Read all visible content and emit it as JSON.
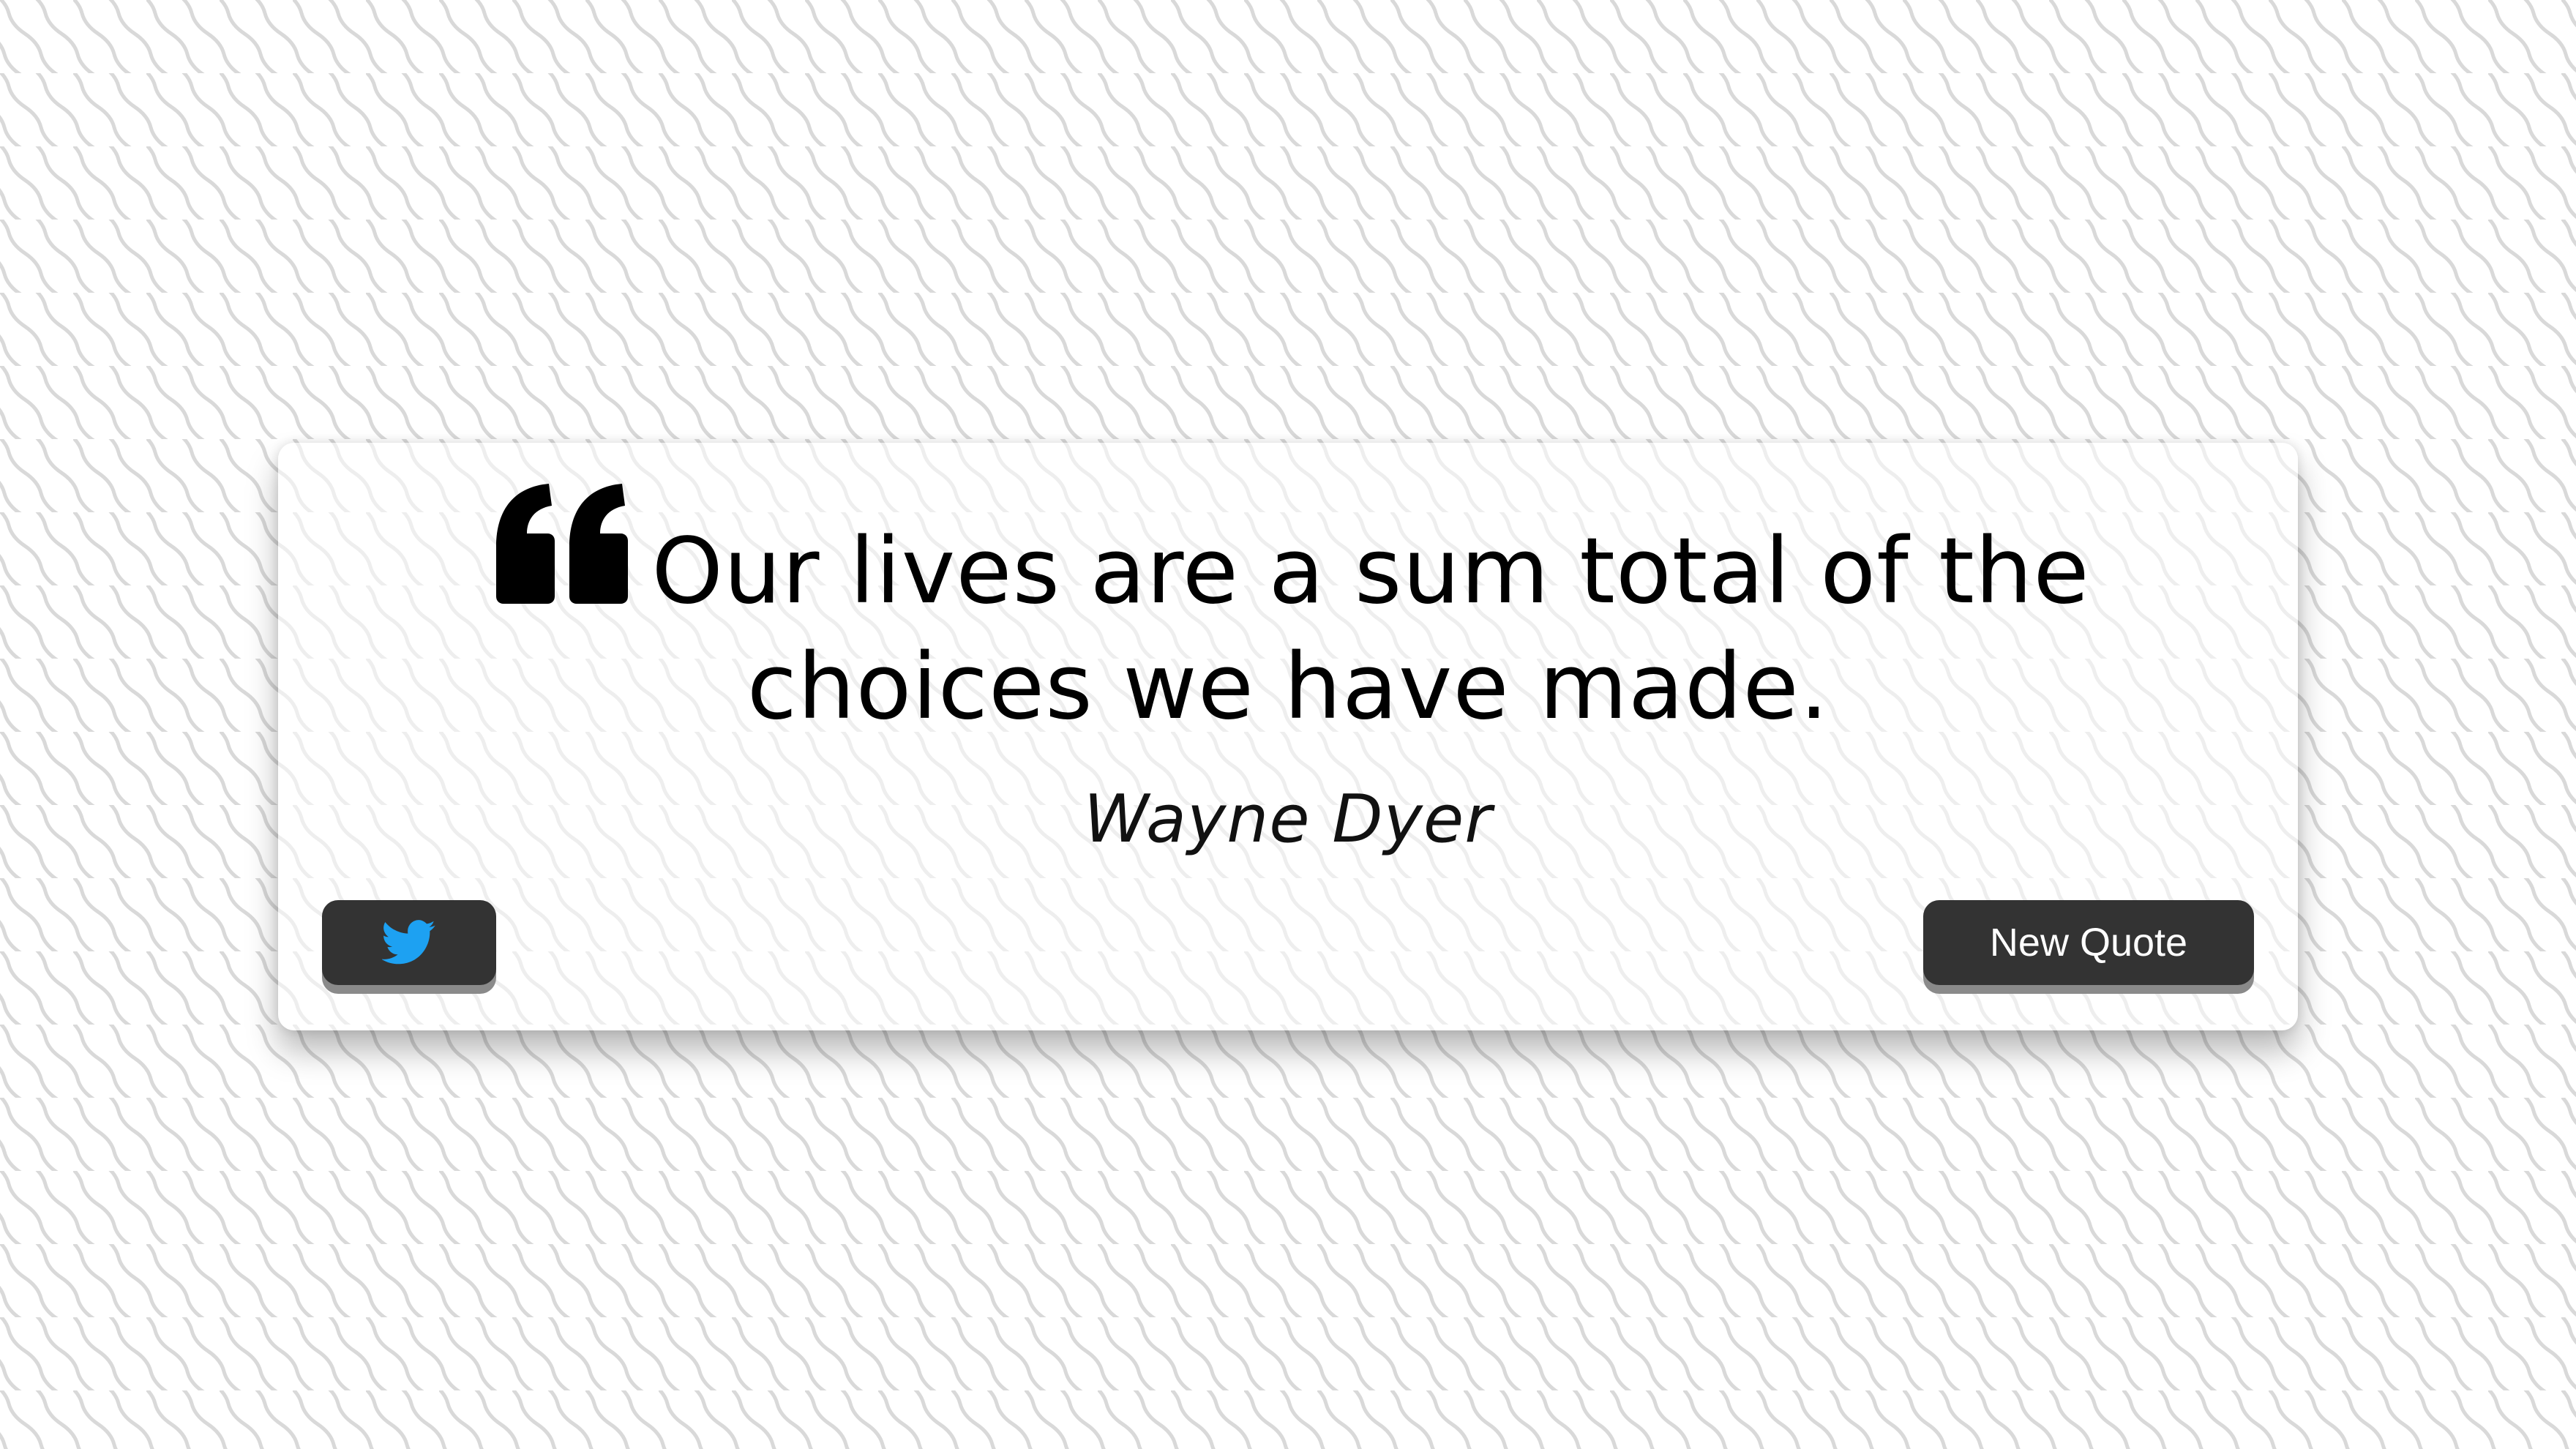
{
  "quote": {
    "text": "Our lives are a sum total of the choices we have made.",
    "author": "Wayne Dyer",
    "icon": "quote-left-icon"
  },
  "actions": {
    "tweet_icon": "twitter-icon",
    "new_quote_label": "New Quote"
  },
  "colors": {
    "button_background": "#333333",
    "button_shadow": "#8a8a8a",
    "twitter_blue": "#1DA1F2",
    "text": "#000000",
    "pattern_stroke": "#d9d9d9"
  }
}
